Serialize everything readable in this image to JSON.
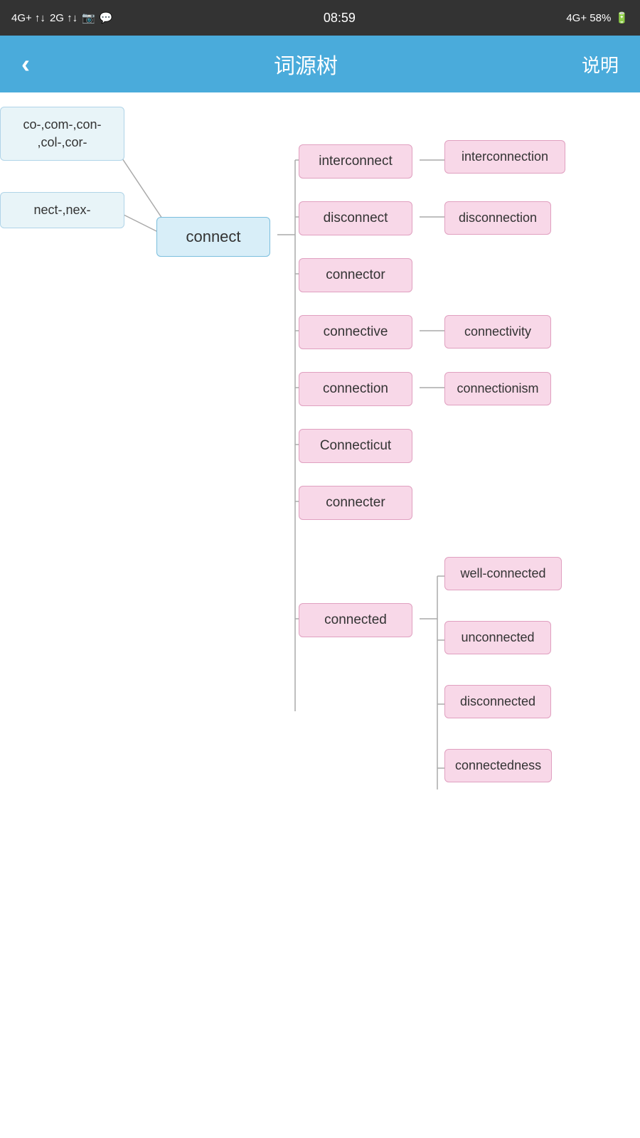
{
  "statusBar": {
    "left": "4G+ 2G ↑↓",
    "time": "08:59",
    "right": "4G+ 58%"
  },
  "header": {
    "back": "‹",
    "title": "词源树",
    "action": "说明"
  },
  "tree": {
    "prefixes": [
      "co-,com-,con-\n,col-,cor-",
      "nect-,nex-"
    ],
    "root": "connect",
    "level2": [
      "interconnect",
      "disconnect",
      "connector",
      "connective",
      "connection",
      "Connecticut",
      "connecter",
      "connected"
    ],
    "level3": {
      "interconnect": [
        "interconnection"
      ],
      "disconnect": [
        "disconnection"
      ],
      "connective": [
        "connectivity"
      ],
      "connection": [
        "connectionism"
      ],
      "connected": [
        "well-connected",
        "unconnected",
        "disconnected",
        "connectedness"
      ]
    }
  }
}
